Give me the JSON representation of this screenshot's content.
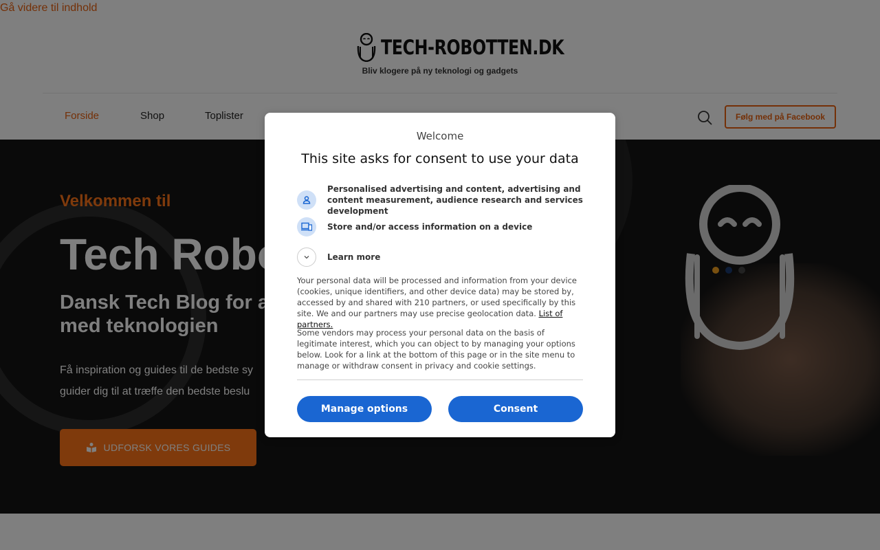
{
  "skip_link": "Gå videre til indhold",
  "header": {
    "logo_text": "TECH-ROBOTTEN.DK",
    "tagline": "Bliv klogere på ny teknologi og gadgets"
  },
  "nav": {
    "items": [
      {
        "label": "Forside",
        "active": true
      },
      {
        "label": "Shop"
      },
      {
        "label": "Toplister"
      }
    ],
    "facebook_button": "Følg med på Facebook"
  },
  "hero": {
    "welcome": "Velkommen til",
    "title": "Tech Robo",
    "subtitle": "Dansk Tech Blog for a med teknologien",
    "subtitle_line1": "Dansk Tech Blog for a",
    "subtitle_line2": "med teknologien",
    "desc_line1": "Få inspiration og guides til de bedste sy",
    "desc_line2": "guider dig til at træffe den bedste beslu",
    "cta_label": "UDFORSK VORES GUIDES"
  },
  "consent": {
    "welcome": "Welcome",
    "title": "This site asks for consent to use your data",
    "purposes": [
      {
        "label": "Personalised advertising and content, advertising and content measurement, audience research and services development",
        "icon": "person-icon"
      },
      {
        "label": "Store and/or access information on a device",
        "icon": "device-icon"
      },
      {
        "label": "Learn more",
        "icon": "chevron-down-icon"
      }
    ],
    "para1": "Your personal data will be processed and information from your device (cookies, unique identifiers, and other device data) may be stored by, accessed by and shared with 210 partners, or used specifically by this site. We and our partners may use precise geolocation data.",
    "partners_link": "List of partners.",
    "para2": "Some vendors may process your personal data on the basis of legitimate interest, which you can object to by managing your options below. Look for a link at the bottom of this page or in the site menu to manage or withdraw consent in privacy and cookie settings.",
    "manage_button": "Manage options",
    "consent_button": "Consent"
  },
  "colors": {
    "accent_orange": "#e8600f",
    "consent_blue": "#1a66d2"
  }
}
